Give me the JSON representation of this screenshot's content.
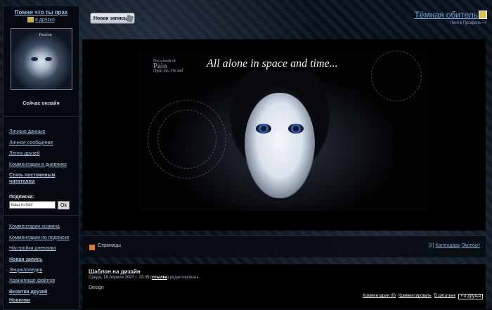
{
  "sidebar": {
    "title": "Помни что ты прах",
    "friend_link": "в друзья",
    "avatar_text": "Passion",
    "online": "Сейчас онлайн",
    "nav": [
      {
        "label": "Личные данные",
        "bold": false
      },
      {
        "label": "Личное сообщение",
        "bold": false
      },
      {
        "label": "Лента друзей",
        "bold": false
      },
      {
        "label": "Комментарии в дневнике",
        "bold": false
      },
      {
        "label": "Стать постоянным читателем",
        "bold": true
      }
    ],
    "subscribe": {
      "label": "Подписка:",
      "placeholder": "Ваш e-mail",
      "button": "Ok"
    },
    "nav2": [
      {
        "label": "Комментарии хозяина",
        "bold": false
      },
      {
        "label": "Комментарии по подписке",
        "bold": false
      },
      {
        "label": "Настройки дневника",
        "bold": false
      },
      {
        "label": "Новая запись",
        "bold": true
      },
      {
        "label": "Энциклопедия",
        "bold": false
      },
      {
        "label": "Хранилище файлов",
        "bold": false
      },
      {
        "label": "Визитки друзей",
        "bold": true
      },
      {
        "label": "Новинки",
        "bold": true
      }
    ]
  },
  "header": {
    "new_post": "Новая запись",
    "site_title": "Тёмная обитель",
    "links": "Лента Профиль-->"
  },
  "banner": {
    "caption": "All alone in space and time...",
    "poem_line1": "I'm a book of",
    "poem_line2": "Pain",
    "poem_line3": "Open me, I'm sad"
  },
  "pages_bar": {
    "label": "Страницы",
    "count": "[2]",
    "calendar": "Календарь",
    "export": "Экспорт"
  },
  "post": {
    "title": "Шаблон на дизайн",
    "date": "Среда, 18 Апреля 2007 г. 23:05",
    "link": "ссылка",
    "edit": "редактировать",
    "body": "Design",
    "comments": "Комментарии (0)",
    "comment": "Комментировать",
    "quote": "В цитатник",
    "friends": "+ в друзья"
  }
}
